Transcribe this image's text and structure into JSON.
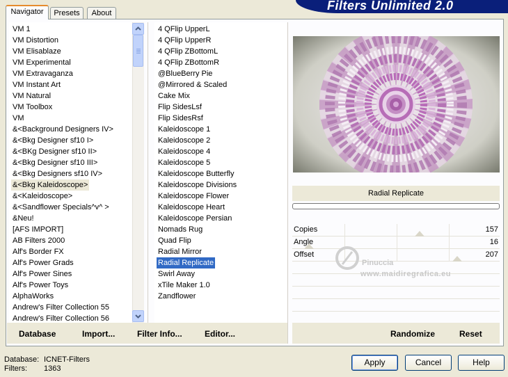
{
  "header": {
    "title": "Filters Unlimited 2.0"
  },
  "tabs": [
    {
      "label": "Navigator",
      "active": true
    },
    {
      "label": "Presets",
      "active": false
    },
    {
      "label": "About",
      "active": false
    }
  ],
  "categories": {
    "items": [
      "VM 1",
      "VM Distortion",
      "VM Elisablaze",
      "VM Experimental",
      "VM Extravaganza",
      "VM Instant Art",
      "VM Natural",
      "VM Toolbox",
      "VM",
      "&<Background Designers IV>",
      "&<Bkg Designer sf10 I>",
      "&<BKg Designer sf10 II>",
      "&<Bkg Designer sf10 III>",
      "&<Bkg Designers sf10 IV>",
      "&<Bkg Kaleidoscope>",
      "&<Kaleidoscope>",
      "&<Sandflower Specials^v^ >",
      "&Neu!",
      "[AFS IMPORT]",
      "AB Filters 2000",
      "Alf's Border FX",
      "Alf's Power Grads",
      "Alf's Power Sines",
      "Alf's Power Toys",
      "AlphaWorks",
      "Andrew's Filter Collection 55",
      "Andrew's Filter Collection 56"
    ],
    "selected_index": 14
  },
  "filters": {
    "items": [
      "4 QFlip UpperL",
      "4 QFlip UpperR",
      "4 QFlip ZBottomL",
      "4 QFlip ZBottomR",
      "@BlueBerry Pie",
      "@Mirrored & Scaled",
      "Cake Mix",
      "Flip SidesLsf",
      "Flip SidesRsf",
      "Kaleidoscope 1",
      "Kaleidoscope 2",
      "Kaleidoscope 4",
      "Kaleidoscope 5",
      "Kaleidoscope Butterfly",
      "Kaleidoscope Divisions",
      "Kaleidoscope Flower",
      "Kaleidoscope Heart",
      "Kaleidoscope Persian",
      "Nomads Rug",
      "Quad Flip",
      "Radial Mirror",
      "Radial Replicate",
      "Swirl Away",
      "xTile Maker 1.0",
      "Zandflower"
    ],
    "selected_index": 21
  },
  "left_buttons": {
    "database": "Database",
    "import": "Import...",
    "filter_info": "Filter Info...",
    "editor": "Editor..."
  },
  "right_panel": {
    "filter_name": "Radial Replicate",
    "params": [
      {
        "label": "Copies",
        "value": "157",
        "fraction": 0.62
      },
      {
        "label": "Angle",
        "value": "16",
        "fraction": 0.06
      },
      {
        "label": "Offset",
        "value": "207",
        "fraction": 0.81
      }
    ],
    "randomize": "Randomize",
    "reset": "Reset"
  },
  "watermark": {
    "line1": "Pinuccia",
    "line2": "www.maidiregrafica.eu"
  },
  "footer": {
    "database_label": "Database:",
    "database_value": "ICNET-Filters",
    "filters_label": "Filters:",
    "filters_value": "1363",
    "apply": "Apply",
    "cancel": "Cancel",
    "help": "Help"
  },
  "colors": {
    "banner": "#0a1f7a",
    "selection_blue": "#316ac5",
    "preview_purple": "#b06ab0"
  }
}
